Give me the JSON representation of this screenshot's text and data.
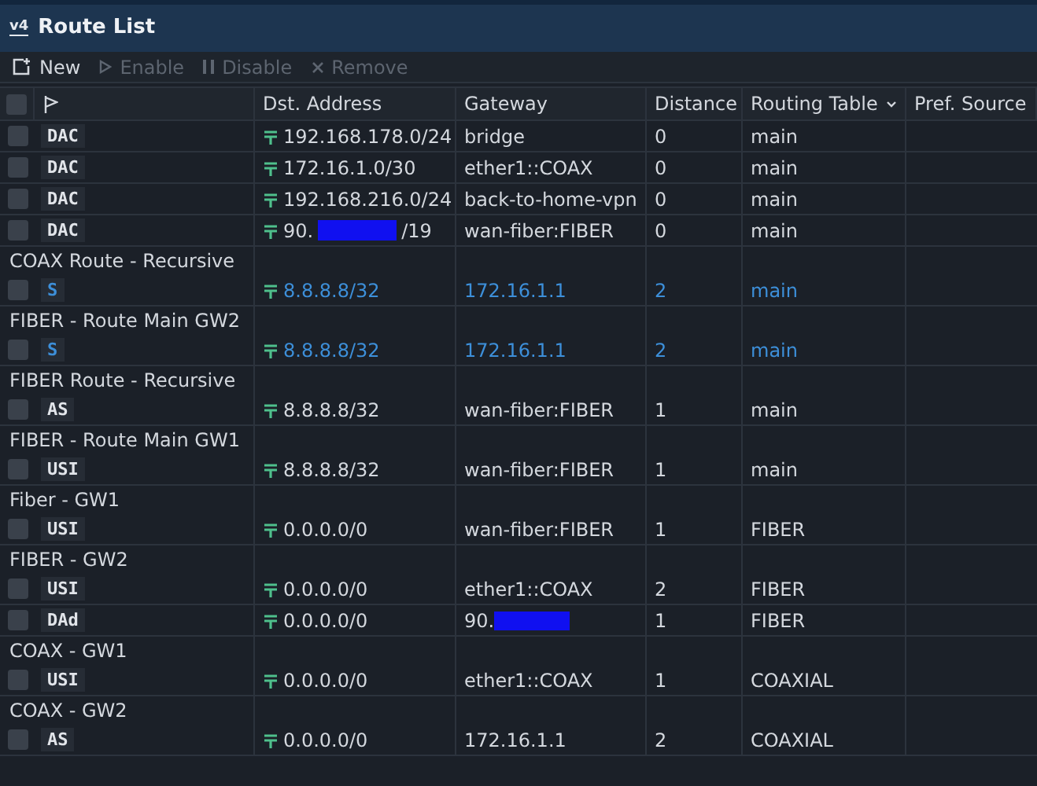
{
  "window": {
    "title": "Route List",
    "logo": "v4"
  },
  "toolbar": [
    {
      "label": "New",
      "disabled": false,
      "kind": "new"
    },
    {
      "label": "Enable",
      "disabled": true,
      "kind": "enable"
    },
    {
      "label": "Disable",
      "disabled": true,
      "kind": "disable"
    },
    {
      "label": "Remove",
      "disabled": true,
      "kind": "remove"
    }
  ],
  "table": {
    "select_all": {
      "checked": false
    },
    "columns": [
      "Dst. Address",
      "Gateway",
      "Distance",
      "Routing Table",
      "Pref. Source"
    ],
    "rows": [
      {
        "checked": false,
        "flags": "DAC",
        "dst": "192.168.178.0/24",
        "gateway": "bridge",
        "distance": "0",
        "routing_table": "main",
        "highlighted": false
      },
      {
        "checked": false,
        "flags": "DAC",
        "dst": "172.16.1.0/30",
        "gateway": "ether1::COAX",
        "distance": "0",
        "routing_table": "main",
        "highlighted": false
      },
      {
        "checked": false,
        "flags": "DAC",
        "dst": "192.168.216.0/24",
        "gateway": "back-to-home-vpn",
        "distance": "0",
        "routing_table": "main",
        "highlighted": false
      },
      {
        "checked": false,
        "flags": "DAC",
        "dst": "90.",
        "dst_redacted": true,
        "dst_suffix": "/19",
        "gateway": "wan-fiber:FIBER",
        "distance": "0",
        "routing_table": "main",
        "highlighted": false
      },
      {
        "comment": "COAX Route - Recursive",
        "checked": false,
        "flags": "S",
        "dst": "8.8.8.8/32",
        "gateway": "172.16.1.1",
        "distance": "2",
        "routing_table": "main",
        "highlighted": true
      },
      {
        "comment": "FIBER - Route Main GW2",
        "checked": false,
        "flags": "S",
        "dst": "8.8.8.8/32",
        "gateway": "172.16.1.1",
        "distance": "2",
        "routing_table": "main",
        "highlighted": true
      },
      {
        "comment": "FIBER Route - Recursive",
        "checked": false,
        "flags": "AS",
        "dst": "8.8.8.8/32",
        "gateway": "wan-fiber:FIBER",
        "distance": "1",
        "routing_table": "main",
        "highlighted": false
      },
      {
        "comment": "FIBER - Route Main GW1",
        "checked": false,
        "flags": "USI",
        "dst": "8.8.8.8/32",
        "gateway": "wan-fiber:FIBER",
        "distance": "1",
        "routing_table": "main",
        "highlighted": false
      },
      {
        "comment": "Fiber - GW1",
        "checked": false,
        "flags": "USI",
        "dst": "0.0.0.0/0",
        "gateway": "wan-fiber:FIBER",
        "distance": "1",
        "routing_table": "FIBER",
        "highlighted": false
      },
      {
        "comment": "FIBER - GW2",
        "checked": false,
        "flags": "USI",
        "dst": "0.0.0.0/0",
        "gateway": "ether1::COAX",
        "distance": "2",
        "routing_table": "FIBER",
        "highlighted": false
      },
      {
        "checked": false,
        "flags": "DAd",
        "dst": "0.0.0.0/0",
        "gateway": "90.",
        "gateway_redacted": true,
        "distance": "1",
        "routing_table": "FIBER",
        "highlighted": false
      },
      {
        "comment": "COAX - GW1",
        "checked": false,
        "flags": "USI",
        "dst": "0.0.0.0/0",
        "gateway": "ether1::COAX",
        "distance": "1",
        "routing_table": "COAXIAL",
        "highlighted": false
      },
      {
        "comment": "COAX - GW2",
        "checked": false,
        "flags": "AS",
        "dst": "0.0.0.0/0",
        "gateway": "172.16.1.1",
        "distance": "2",
        "routing_table": "COAXIAL",
        "highlighted": false
      }
    ]
  }
}
